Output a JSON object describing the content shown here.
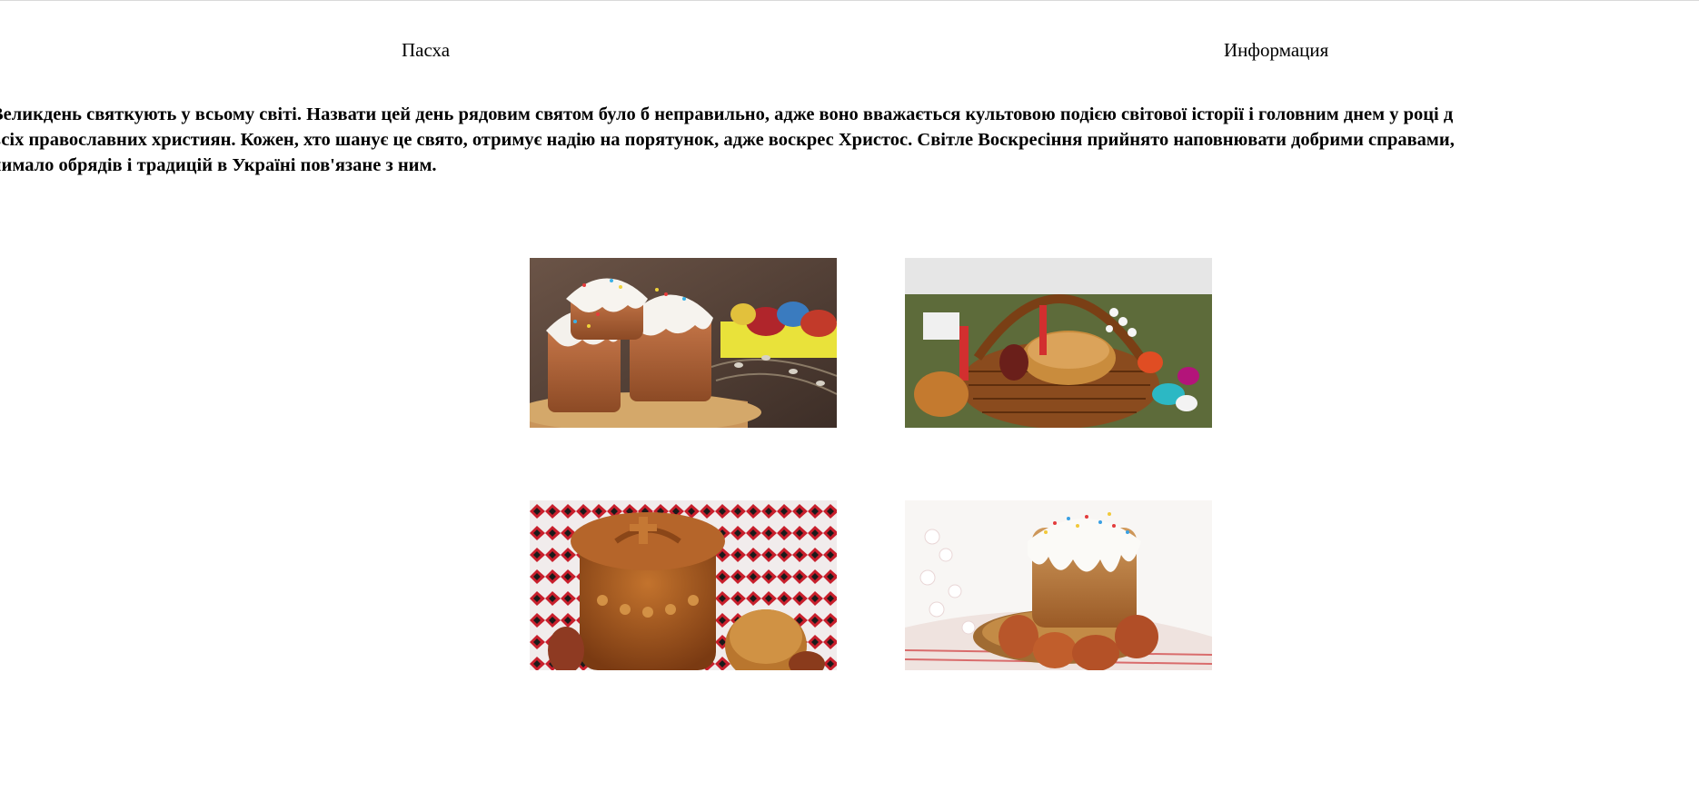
{
  "nav": {
    "items": [
      {
        "label": "Пасха"
      },
      {
        "label": "Информация"
      }
    ]
  },
  "intro": {
    "lines": [
      "Великдень святкують у всьому світі. Назвати цей день рядовим святом було б неправильно, адже воно вважається культовою подією світової історії і головним днем у році д",
      "всіх православних християн. Кожен, хто шанує це свято, отримує надію на порятунок, адже воскрес Христос. Світле Воскресіння прийнято наповнювати добрими справами,",
      "чимало обрядів і традицій в Україні пов'язане з ним."
    ]
  },
  "gallery": {
    "images": [
      {
        "subject": "Easter cakes with white glaze and sprinkles on wooden board"
      },
      {
        "subject": "Wicker Easter basket with paska, candle and painted eggs"
      },
      {
        "subject": "Decorated korovai bread on embroidered red-black cloth"
      },
      {
        "subject": "Glazed paska with brown eggs and blossoms on plate"
      }
    ]
  }
}
